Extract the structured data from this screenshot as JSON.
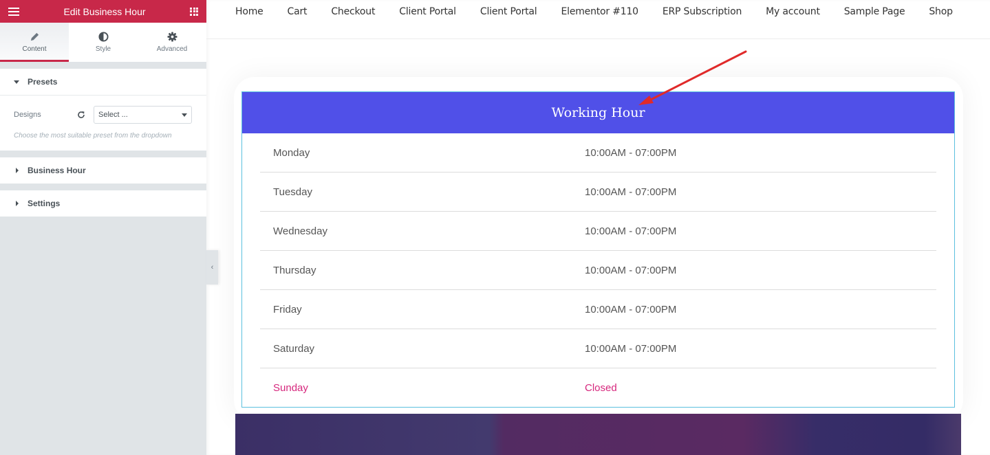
{
  "panel": {
    "title": "Edit Business Hour",
    "tabs": [
      {
        "label": "Content",
        "icon": "pencil-icon",
        "active": true
      },
      {
        "label": "Style",
        "icon": "half-circle-icon",
        "active": false
      },
      {
        "label": "Advanced",
        "icon": "gear-icon",
        "active": false
      }
    ],
    "sections": {
      "presets": {
        "label": "Presets",
        "designs_label": "Designs",
        "select_value": "Select ...",
        "description": "Choose the most suitable preset from the dropdown"
      },
      "business_hour": {
        "label": "Business Hour"
      },
      "settings": {
        "label": "Settings"
      }
    }
  },
  "nav": {
    "links": [
      "Home",
      "Cart",
      "Checkout",
      "Client Portal",
      "Client Portal",
      "Elementor #110",
      "ERP Subscription",
      "My account",
      "Sample Page",
      "Shop"
    ]
  },
  "widget": {
    "title": "Working Hour",
    "header_color": "#5050e8",
    "closed_color": "#d6277d",
    "rows": [
      {
        "day": "Monday",
        "hours": "10:00AM - 07:00PM",
        "closed": false
      },
      {
        "day": "Tuesday",
        "hours": "10:00AM - 07:00PM",
        "closed": false
      },
      {
        "day": "Wednesday",
        "hours": "10:00AM - 07:00PM",
        "closed": false
      },
      {
        "day": "Thursday",
        "hours": "10:00AM - 07:00PM",
        "closed": false
      },
      {
        "day": "Friday",
        "hours": "10:00AM - 07:00PM",
        "closed": false
      },
      {
        "day": "Saturday",
        "hours": "10:00AM - 07:00PM",
        "closed": false
      },
      {
        "day": "Sunday",
        "hours": "Closed",
        "closed": true
      }
    ]
  },
  "annotation": {
    "type": "red-arrow",
    "color": "#e02a2a",
    "points_to": "widget-title"
  }
}
